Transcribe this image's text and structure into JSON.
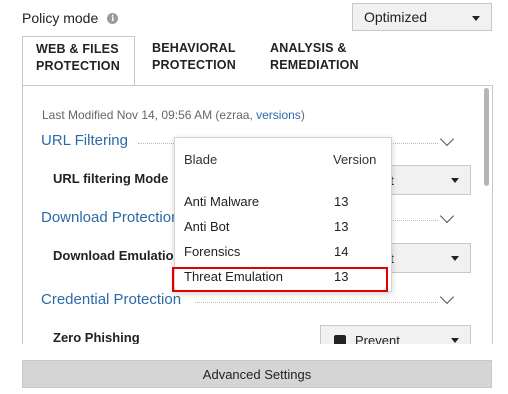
{
  "policy": {
    "label": "Policy mode",
    "value": "Optimized"
  },
  "tabs": [
    {
      "line1": "WEB & FILES",
      "line2": "PROTECTION"
    },
    {
      "line1": "BEHAVIORAL",
      "line2": "PROTECTION"
    },
    {
      "line1": "ANALYSIS &",
      "line2": "REMEDIATION"
    }
  ],
  "panel": {
    "last_modified_text": "Last Modified Nov 14, 09:56 AM (ezraa, ",
    "versions_link": "versions",
    "close_paren": ")"
  },
  "sections": [
    {
      "title": "URL Filtering",
      "row_label": "URL filtering Mode",
      "row_value": "nt"
    },
    {
      "title": "Download Protection",
      "row_label": "Download Emulation",
      "row_value": "nt"
    },
    {
      "title": "Credential Protection",
      "row_label": "Zero Phishing",
      "row_value": "Prevent"
    }
  ],
  "popover": {
    "col_blade": "Blade",
    "col_version": "Version",
    "rows": [
      {
        "blade": "Anti Malware",
        "version": "13"
      },
      {
        "blade": "Anti Bot",
        "version": "13"
      },
      {
        "blade": "Forensics",
        "version": "14"
      },
      {
        "blade": "Threat Emulation",
        "version": "13"
      }
    ]
  },
  "advanced_settings_label": "Advanced Settings"
}
